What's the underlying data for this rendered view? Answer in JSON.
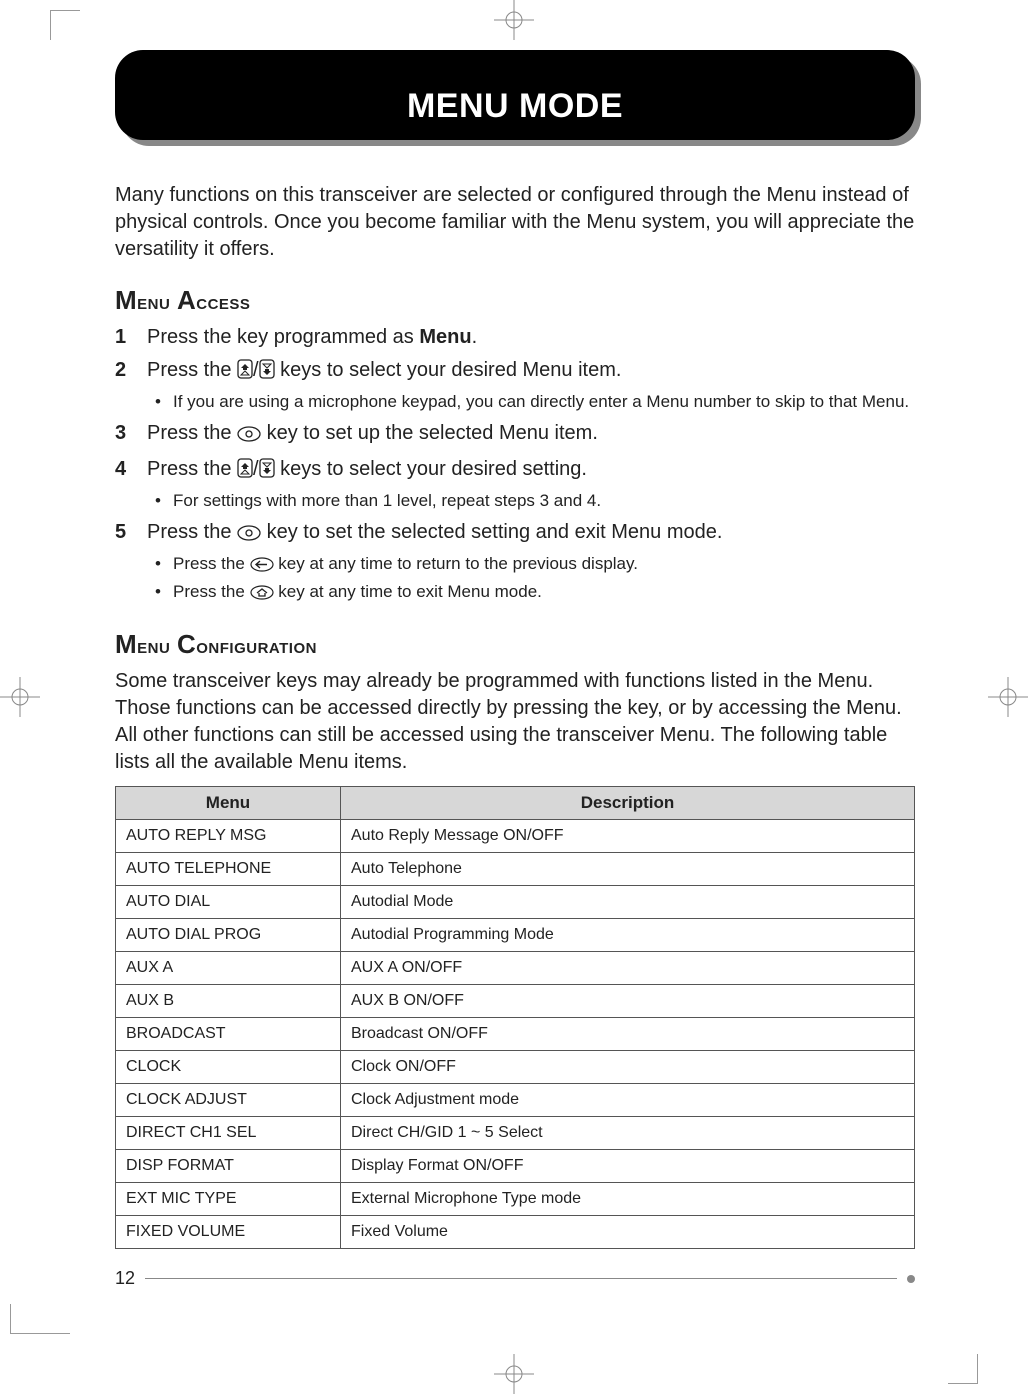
{
  "title": "MENU MODE",
  "intro": "Many functions on this transceiver are selected or configured through the Menu instead of physical controls.  Once you become familiar with the Menu system, you will appreciate the versatility it offers.",
  "section_access": "Menu Access",
  "section_config": "Menu Configuration",
  "steps": {
    "s1_a": "Press the key programmed as ",
    "s1_menu": "Menu",
    "s1_b": ".",
    "s2": "Press the ",
    "s2b": " keys to select your desired Menu item.",
    "s2_sub": "If you are using a microphone keypad, you can directly enter a Menu number to skip to that Menu.",
    "s3a": "Press the ",
    "s3b": " key to set up the selected Menu item.",
    "s4a": "Press the ",
    "s4b": " keys to select your desired setting.",
    "s4_sub": "For settings with more than 1 level, repeat steps 3 and 4.",
    "s5a": "Press the ",
    "s5b": " key to set the selected setting and exit Menu mode.",
    "s5_sub1a": "Press the ",
    "s5_sub1b": " key at any time to return to the previous display.",
    "s5_sub2a": "Press the ",
    "s5_sub2b": " key at any time to exit Menu mode."
  },
  "config_para": "Some transceiver keys may already be programmed with functions listed in the Menu.  Those functions can be accessed directly by pressing the key, or by accessing the Menu.  All other functions can still be accessed using the transceiver Menu.  The following table lists all the available Menu items.",
  "table": {
    "headers": {
      "menu": "Menu",
      "desc": "Description"
    },
    "rows": [
      {
        "menu": "AUTO REPLY MSG",
        "desc": "Auto Reply Message ON/OFF"
      },
      {
        "menu": "AUTO TELEPHONE",
        "desc": "Auto Telephone"
      },
      {
        "menu": "AUTO DIAL",
        "desc": "Autodial Mode"
      },
      {
        "menu": "AUTO DIAL PROG",
        "desc": "Autodial Programming Mode"
      },
      {
        "menu": "AUX A",
        "desc": "AUX A ON/OFF"
      },
      {
        "menu": "AUX B",
        "desc": "AUX B ON/OFF"
      },
      {
        "menu": "BROADCAST",
        "desc": "Broadcast ON/OFF"
      },
      {
        "menu": "CLOCK",
        "desc": "Clock ON/OFF"
      },
      {
        "menu": "CLOCK ADJUST",
        "desc": "Clock Adjustment mode"
      },
      {
        "menu": "DIRECT CH1 SEL",
        "desc": "Direct CH/GID 1 ~ 5 Select"
      },
      {
        "menu": "DISP FORMAT",
        "desc": "Display Format ON/OFF"
      },
      {
        "menu": "EXT MIC TYPE",
        "desc": "External Microphone Type mode"
      },
      {
        "menu": "FIXED VOLUME",
        "desc": "Fixed Volume"
      }
    ]
  },
  "page_number": "12",
  "icons": {
    "up": "up-icon",
    "down": "down-icon",
    "ok": "ok-icon",
    "back": "back-icon",
    "home": "home-icon"
  }
}
